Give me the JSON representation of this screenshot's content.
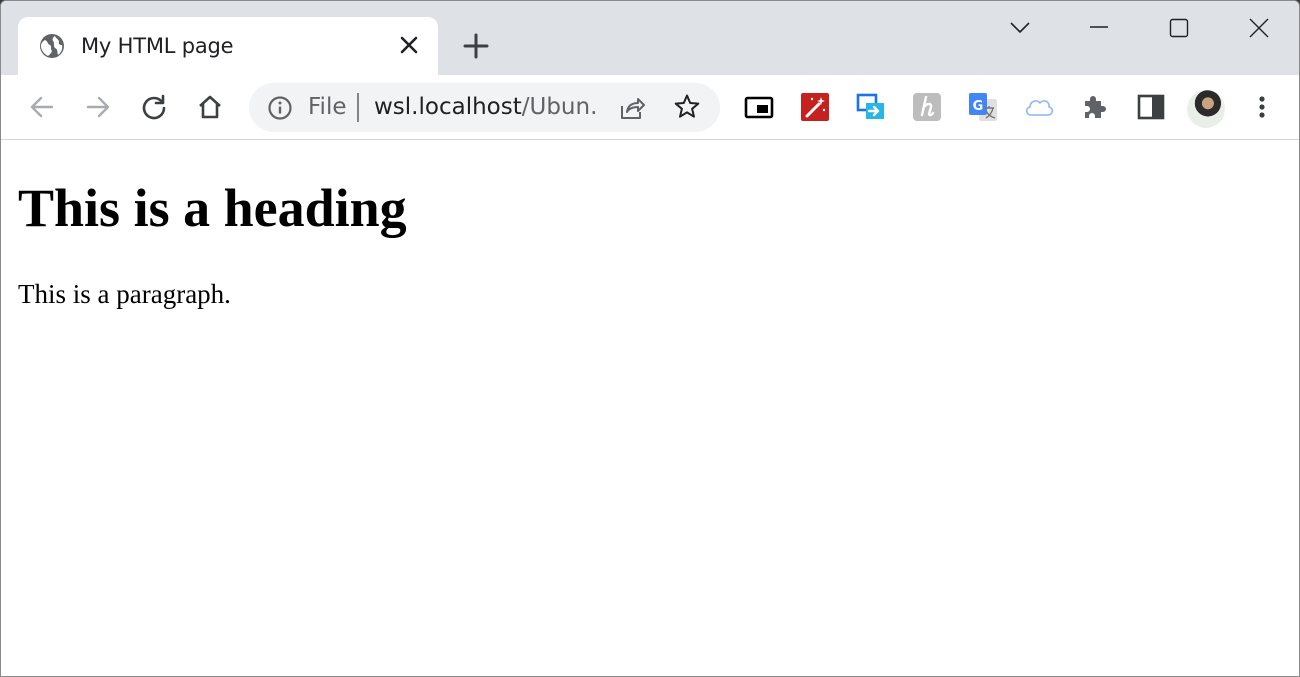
{
  "tab": {
    "title": "My HTML page",
    "favicon_icon": "globe-icon",
    "close_icon": "close-icon"
  },
  "window_controls": {
    "tab_search_icon": "chevron-down-icon",
    "minimize_icon": "minimize-icon",
    "maximize_icon": "maximize-icon",
    "close_icon": "close-icon"
  },
  "toolbar": {
    "back_icon": "back-arrow-icon",
    "forward_icon": "forward-arrow-icon",
    "reload_icon": "reload-icon",
    "home_icon": "home-icon",
    "extensions": [
      "picture-in-picture-icon",
      "magic-wand-icon",
      "screen-share-icon",
      "h-extension-icon",
      "google-translate-icon",
      "cloud-icon",
      "puzzle-piece-icon",
      "side-panel-icon"
    ],
    "menu_icon": "kebab-menu-icon"
  },
  "omnibox": {
    "scheme": "File",
    "url_host": "wsl.localhost",
    "url_rest": "/Ubun...",
    "info_icon": "info-icon",
    "share_icon": "share-icon",
    "bookmark_icon": "star-icon"
  },
  "page": {
    "heading": "This is a heading",
    "paragraph": "This is a paragraph."
  },
  "colors": {
    "tabstrip_bg": "#dee1e6",
    "omnibox_bg": "#f1f3f4",
    "icon_gray": "#5f6368",
    "icon_disabled": "#a8abaf"
  }
}
